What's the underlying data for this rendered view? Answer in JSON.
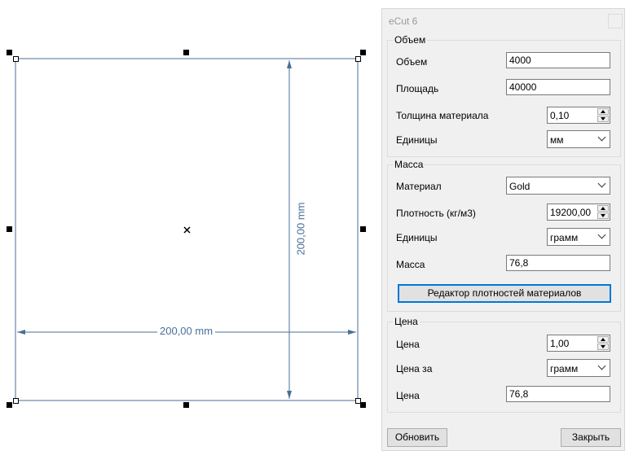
{
  "drawing": {
    "width_label": "200,00 mm",
    "height_label": "200,00 mm",
    "center_icon": "cross-icon",
    "line_color": "#4a6f97"
  },
  "window": {
    "title": "eCut 6"
  },
  "volume_group": {
    "title": "Объем",
    "volume_label": "Объем",
    "volume_value": "4000",
    "area_label": "Площадь",
    "area_value": "40000",
    "thickness_label": "Толщина материала",
    "thickness_value": "0,10",
    "units_label": "Единицы",
    "units_value": "мм"
  },
  "mass_group": {
    "title": "Масса",
    "material_label": "Материал",
    "material_value": "Gold",
    "density_label": "Плотность (кг/м3)",
    "density_value": "19200,00",
    "units_label": "Единицы",
    "units_value": "грамм",
    "mass_label": "Масса",
    "mass_value": "76,8",
    "editor_button": "Редактор плотностей материалов"
  },
  "price_group": {
    "title": "Цена",
    "price_label": "Цена",
    "price_value": "1,00",
    "price_per_label": "Цена за",
    "price_per_value": "грамм",
    "total_label": "Цена",
    "total_value": "76,8"
  },
  "buttons": {
    "refresh": "Обновить",
    "close": "Закрыть"
  },
  "colors": {
    "accent": "#0078d7",
    "dimension": "#4a6f97"
  }
}
